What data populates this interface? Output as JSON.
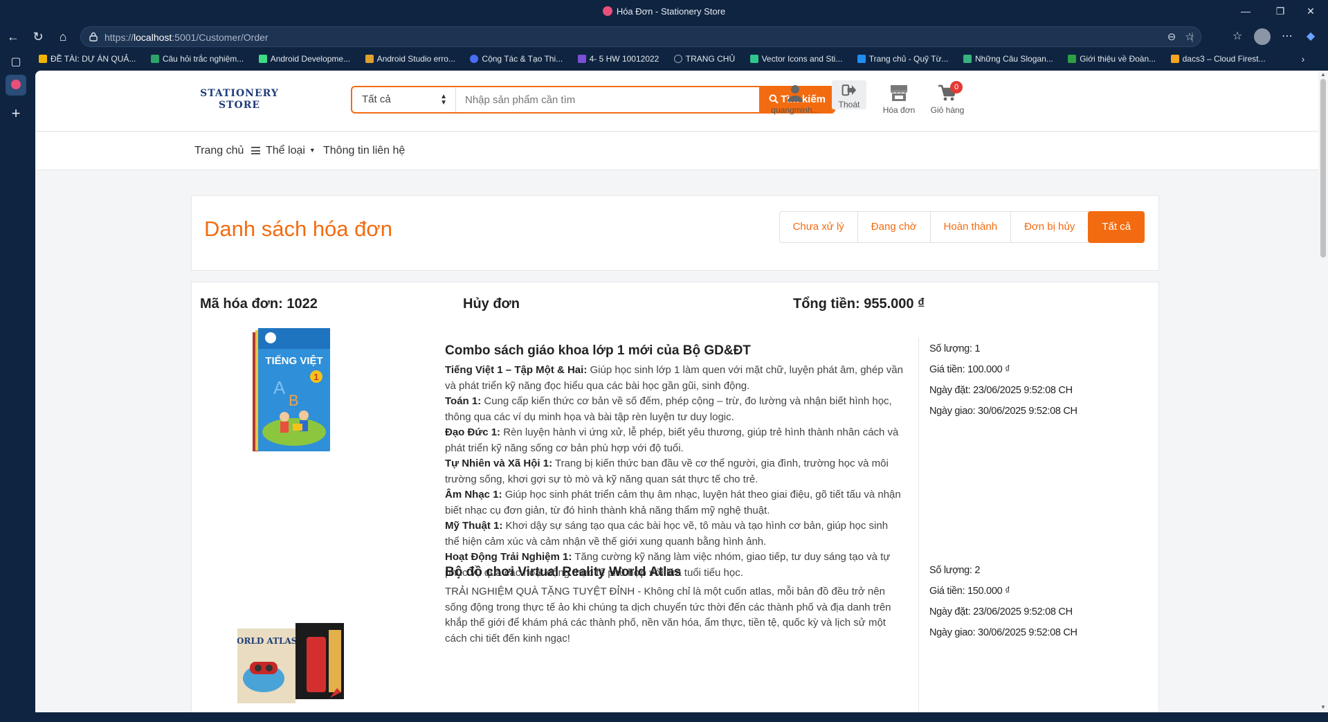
{
  "window": {
    "title": "Hóa Đơn - Stationery Store",
    "controls": [
      "—",
      "❐",
      "✕"
    ]
  },
  "browser": {
    "url_prefix": "https://",
    "url_host": "localhost",
    "url_path": ":5001/Customer/Order",
    "bookmarks": [
      {
        "label": "ĐỀ TÀI: DỰ ÁN QUẢ...",
        "color": "#f0b400"
      },
      {
        "label": "Câu hỏi trắc nghiệm...",
        "color": "#2fa36b"
      },
      {
        "label": "Android Developme...",
        "color": "#3ddc84"
      },
      {
        "label": "Android Studio erro...",
        "color": "#e0a030"
      },
      {
        "label": "Cộng Tác & Tạo Thi...",
        "color": "#4a6cf7"
      },
      {
        "label": "4- 5 HW 10012022",
        "color": "#7b4fd6"
      },
      {
        "label": "TRANG CHỦ",
        "color": "#9aa6b5"
      },
      {
        "label": "Vector Icons and Sti...",
        "color": "#31c48d"
      },
      {
        "label": "Trang chủ - Quỹ Từ...",
        "color": "#1f8ef1"
      },
      {
        "label": "Những Câu Slogan...",
        "color": "#36b37e"
      },
      {
        "label": "Giới thiệu về Đoàn...",
        "color": "#2ea043"
      },
      {
        "label": "dacs3 – Cloud Firest...",
        "color": "#f6a623"
      }
    ]
  },
  "store": {
    "logo_line1": "STATIONERY",
    "logo_line2": "STORE",
    "search_category": "Tất cả",
    "search_placeholder": "Nhập sản phẩm cần tìm",
    "search_button": "Tìm kiếm",
    "user_label": "quangminh...",
    "logout_label": "Thoát",
    "invoice_label": "Hóa đơn",
    "cart_label": "Giỏ hàng",
    "cart_count": "0",
    "accent": "#f36b10"
  },
  "menu": {
    "home": "Trang chủ",
    "categories": "Thể loại",
    "contact": "Thông tin liên hệ"
  },
  "orders_page": {
    "heading": "Danh sách hóa đơn",
    "tabs": [
      "Chưa xử lý",
      "Đang chờ",
      "Hoàn thành",
      "Đơn bị hủy",
      "Tất cả"
    ],
    "active_tab": "Tất cả"
  },
  "order": {
    "id_text": "Mã hóa đơn: 1022",
    "status": "Hủy đơn",
    "total": "Tổng tiền: 955.000 ₫",
    "items": [
      {
        "name": "Combo sách giáo khoa lớp 1 mới của Bộ GD&ĐT",
        "desc": [
          {
            "b": "Tiếng Việt 1 – Tập Một & Hai:",
            "t": " Giúp học sinh lớp 1 làm quen với mặt chữ, luyện phát âm, ghép vần và phát triển kỹ năng đọc hiểu qua các bài học gần gũi, sinh động."
          },
          {
            "b": "Toán 1:",
            "t": " Cung cấp kiến thức cơ bản về số đếm, phép cộng – trừ, đo lường và nhận biết hình học, thông qua các ví dụ minh họa và bài tập rèn luyện tư duy logic."
          },
          {
            "b": "Đạo Đức 1:",
            "t": " Rèn luyện hành vi ứng xử, lễ phép, biết yêu thương, giúp trẻ hình thành nhân cách và phát triển kỹ năng sống cơ bản phù hợp với độ tuổi."
          },
          {
            "b": "Tự Nhiên và Xã Hội 1:",
            "t": " Trang bị kiến thức ban đầu về cơ thể người, gia đình, trường học và môi trường sống, khơi gợi sự tò mò và kỹ năng quan sát thực tế cho trẻ."
          },
          {
            "b": "Âm Nhạc 1:",
            "t": " Giúp học sinh phát triển cảm thụ âm nhạc, luyện hát theo giai điệu, gõ tiết tấu và nhận biết nhạc cụ đơn giản, từ đó hình thành khả năng thẩm mỹ nghệ thuật."
          },
          {
            "b": "Mỹ Thuật 1:",
            "t": " Khơi dậy sự sáng tạo qua các bài học vẽ, tô màu và tạo hình cơ bản, giúp học sinh thể hiện cảm xúc và cảm nhận về thế giới xung quanh bằng hình ảnh."
          },
          {
            "b": "Hoạt Động Trải Nghiệm 1:",
            "t": " Tăng cường kỹ năng làm việc nhóm, giao tiếp, tư duy sáng tạo và tự phục vụ qua các hoạt động thực tế phù hợp với lứa tuổi tiểu học."
          }
        ],
        "cover_title": "TIẾNG VIỆT",
        "cover_num": "1",
        "qty": "Số lượng: 1",
        "price": "Giá tiền: 100.000 ₫",
        "ordered": "Ngày đặt: 23/06/2025 9:52:08 CH",
        "delivered": "Ngày giao: 30/06/2025 9:52:08 CH"
      },
      {
        "name": "Bộ đồ chơi Virtual Reality World Atlas",
        "desc_plain": "TRẢI NGHIỆM QUÀ TẶNG TUYỆT ĐỈNH - Không chỉ là một cuốn atlas, mỗi bản đồ đều trở nên sống động trong thực tế ảo khi chúng ta dịch chuyển tức thời đến các thành phố và địa danh trên khắp thế giới để khám phá các thành phố, nền văn hóa, ẩm thực, tiền tệ, quốc kỳ và lịch sử một cách chi tiết đến kinh ngạc!",
        "cover_title": "WORLD ATLAS",
        "qty": "Số lượng: 2",
        "price": "Giá tiền: 150.000 ₫",
        "ordered": "Ngày đặt: 23/06/2025 9:52:08 CH",
        "delivered": "Ngày giao: 30/06/2025 9:52:08 CH"
      }
    ]
  }
}
